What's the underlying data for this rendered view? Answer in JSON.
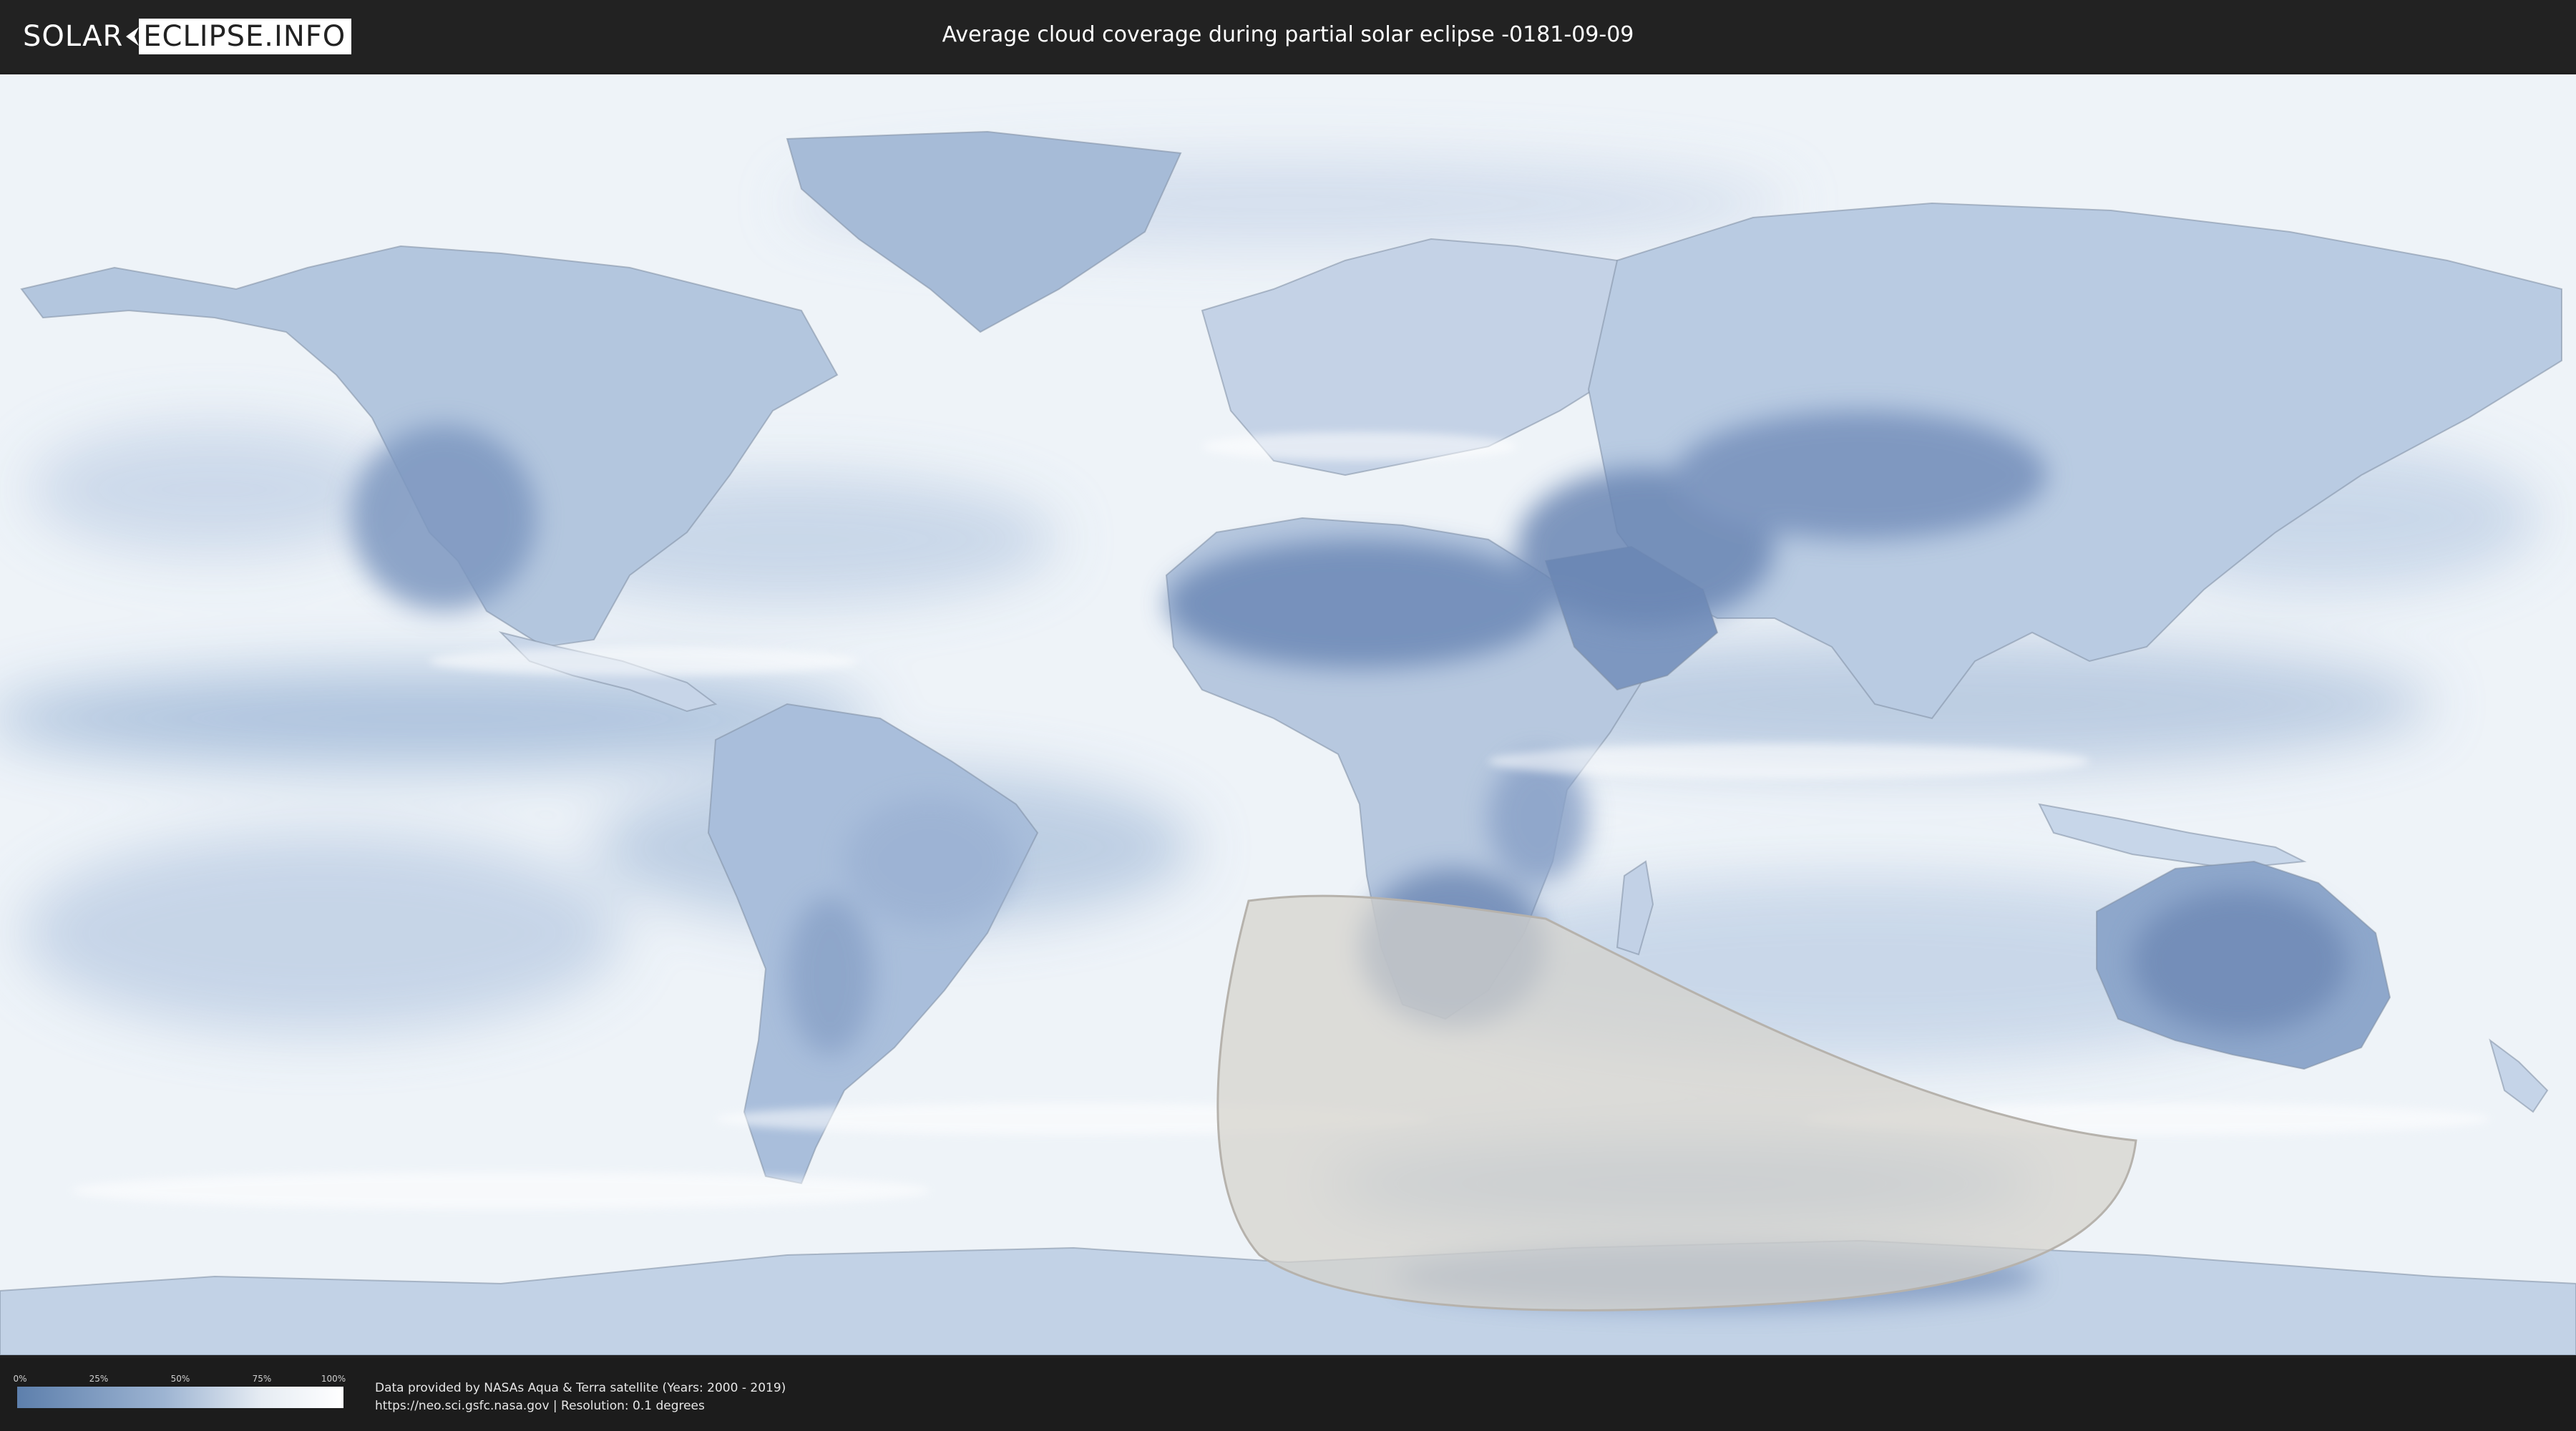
{
  "header": {
    "logo_part1": "SOLAR",
    "logo_part2": "ECLIPSE.INFO",
    "title": "Average cloud coverage during partial solar eclipse -0181-09-09"
  },
  "map": {
    "ocean_color": "#eef3f8",
    "land_clear_color": "#6a88b6",
    "eclipse_overlay_color": "#d6d2cc"
  },
  "legend": {
    "ticks": [
      "0%",
      "25%",
      "50%",
      "75%",
      "100%"
    ],
    "gradient_colors": [
      "#5d7fac",
      "#9db4d2",
      "#e6ecf3",
      "#ffffff"
    ]
  },
  "footer": {
    "source_line1": "Data provided by NASAs Aqua & Terra satellite (Years: 2000 - 2019)",
    "source_line2": "https://neo.sci.gsfc.nasa.gov | Resolution: 0.1 degrees"
  }
}
